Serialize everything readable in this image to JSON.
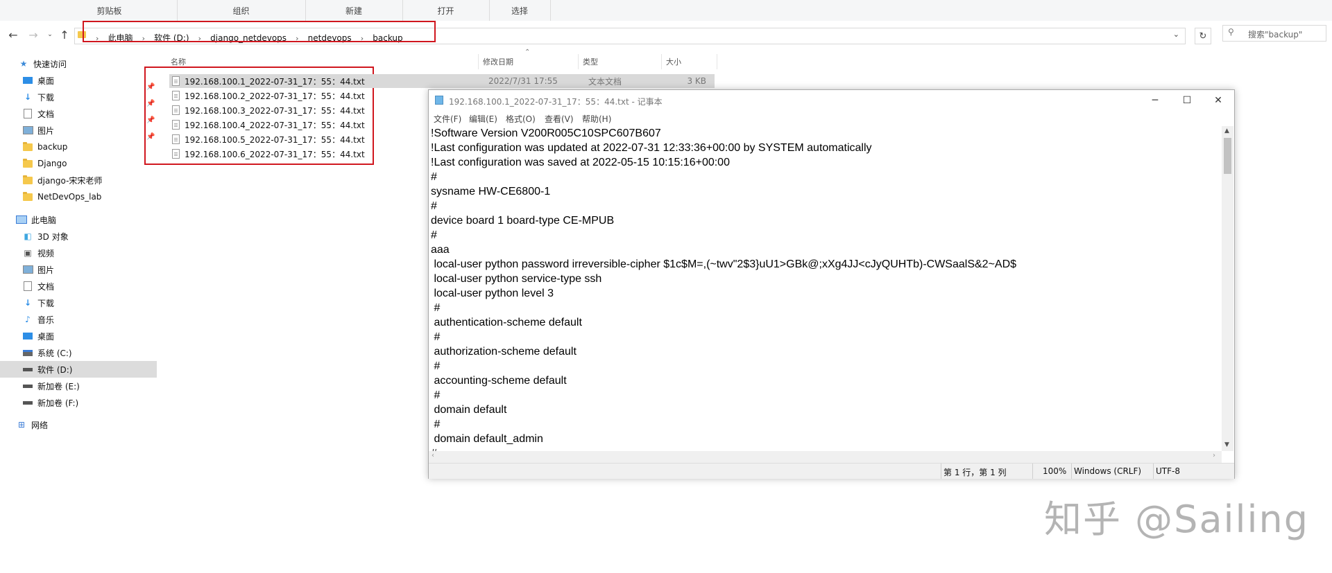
{
  "ribbon": {
    "groups": [
      "剪贴板",
      "组织",
      "新建",
      "打开",
      "选择"
    ]
  },
  "address": {
    "crumbs": [
      "此电脑",
      "软件 (D:)",
      "django_netdevops",
      "netdevops",
      "backup"
    ]
  },
  "search": {
    "placeholder": "搜索\"backup\""
  },
  "sidebar": {
    "quick_access": "快速访问",
    "quick_items": [
      "桌面",
      "下载",
      "文档",
      "图片",
      "backup",
      "Django",
      "django-宋宋老师",
      "NetDevOps_lab"
    ],
    "this_pc": "此电脑",
    "pc_items": [
      "3D 对象",
      "视频",
      "图片",
      "文档",
      "下载",
      "音乐",
      "桌面",
      "系统 (C:)",
      "软件 (D:)",
      "新加卷 (E:)",
      "新加卷 (F:)"
    ],
    "network": "网络"
  },
  "file_list": {
    "columns": {
      "name": "名称",
      "modified": "修改日期",
      "type": "类型",
      "size": "大小"
    },
    "files": [
      {
        "name": "192.168.100.1_2022-07-31_17：55：44.txt",
        "modified": "2022/7/31 17:55",
        "type": "文本文档",
        "size": "3 KB"
      },
      {
        "name": "192.168.100.2_2022-07-31_17：55：44.txt"
      },
      {
        "name": "192.168.100.3_2022-07-31_17：55：44.txt"
      },
      {
        "name": "192.168.100.4_2022-07-31_17：55：44.txt"
      },
      {
        "name": "192.168.100.5_2022-07-31_17：55：44.txt"
      },
      {
        "name": "192.168.100.6_2022-07-31_17：55：44.txt"
      }
    ]
  },
  "notepad": {
    "title": "192.168.100.1_2022-07-31_17：55：44.txt - 记事本",
    "menu": [
      "文件(F)",
      "编辑(E)",
      "格式(O)",
      "查看(V)",
      "帮助(H)"
    ],
    "lines": [
      "!Software Version V200R005C10SPC607B607",
      "!Last configuration was updated at 2022-07-31 12:33:36+00:00 by SYSTEM automatically",
      "!Last configuration was saved at 2022-05-15 10:15:16+00:00",
      "#",
      "sysname HW-CE6800-1",
      "#",
      "device board 1 board-type CE-MPUB",
      "#",
      "aaa",
      " local-user python password irreversible-cipher $1c$M=,(~twv\"2$3}uU1>GBk@;xXg4JJ<cJyQUHTb)-CWSaalS&2~AD$",
      " local-user python service-type ssh",
      " local-user python level 3",
      " #",
      " authentication-scheme default",
      " #",
      " authorization-scheme default",
      " #",
      " accounting-scheme default",
      " #",
      " domain default",
      " #",
      " domain default_admin",
      "#"
    ],
    "status": {
      "position": "第 1 行，第 1 列",
      "zoom": "100%",
      "line_ending": "Windows (CRLF)",
      "encoding": "UTF-8"
    }
  },
  "watermark": "知乎 @Sailing",
  "colors": {
    "highlight_box": "#d0161e",
    "selection": "#d9d9d9"
  }
}
